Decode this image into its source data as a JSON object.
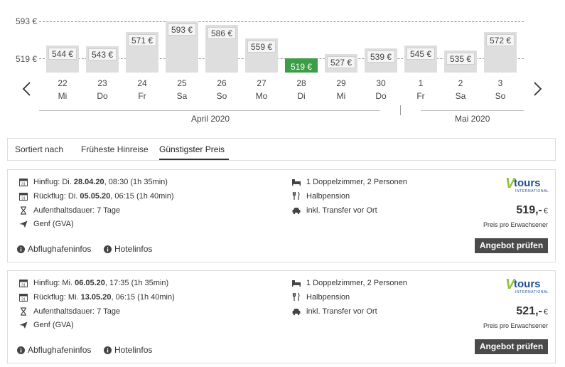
{
  "chart_data": {
    "type": "bar",
    "categories": [
      "22 Mi",
      "23 Do",
      "24 Fr",
      "25 Sa",
      "26 So",
      "27 Mo",
      "28 Di",
      "29 Mi",
      "30 Do",
      "1 Fr",
      "2 Sa",
      "3 So"
    ],
    "days": [
      {
        "num": "22",
        "weekday": "Mi",
        "price_label": "544 €"
      },
      {
        "num": "23",
        "weekday": "Do",
        "price_label": "543 €"
      },
      {
        "num": "24",
        "weekday": "Fr",
        "price_label": "571 €"
      },
      {
        "num": "25",
        "weekday": "Sa",
        "price_label": "593 €"
      },
      {
        "num": "26",
        "weekday": "So",
        "price_label": "586 €"
      },
      {
        "num": "27",
        "weekday": "Mo",
        "price_label": "559 €"
      },
      {
        "num": "28",
        "weekday": "Di",
        "price_label": "519 €"
      },
      {
        "num": "29",
        "weekday": "Mi",
        "price_label": "527 €"
      },
      {
        "num": "30",
        "weekday": "Do",
        "price_label": "539 €"
      },
      {
        "num": "1",
        "weekday": "Fr",
        "price_label": "545 €"
      },
      {
        "num": "2",
        "weekday": "Sa",
        "price_label": "535 €"
      },
      {
        "num": "3",
        "weekday": "So",
        "price_label": "572 €"
      }
    ],
    "values": [
      544,
      543,
      571,
      593,
      586,
      559,
      519,
      527,
      539,
      545,
      535,
      572
    ],
    "selected_index": 6,
    "ref_lines": [
      {
        "value": 593,
        "label": "593 €"
      },
      {
        "value": 519,
        "label": "519 €"
      }
    ],
    "months": [
      {
        "label": "April 2020"
      },
      {
        "label": "Mai 2020"
      }
    ],
    "colors": {
      "bar": "#dedede",
      "selected": "#3d9c46"
    }
  },
  "sort": {
    "label": "Sortiert nach",
    "options": [
      "Früheste Hinreise",
      "Günstigster Preis"
    ],
    "active_index": 1
  },
  "offers": [
    {
      "outbound_prefix": "Hinflug: Di. ",
      "outbound_date": "28.04.20",
      "outbound_suffix": ", 08:30 (1h 35min)",
      "return_prefix": "Rückflug: Di. ",
      "return_date": "05.05.20",
      "return_suffix": ", 06:15 (1h 40min)",
      "duration": "Aufenthaltsdauer: 7 Tage",
      "airport": "Genf (GVA)",
      "room": "1 Doppelzimmer, 2 Personen",
      "board": "Halbpension",
      "transfer": "inkl. Transfer vor Ort",
      "logo_v": "V",
      "logo_text": "tours",
      "logo_sub": "INTERNATIONAL",
      "price": "519,-",
      "currency": "€",
      "price_note": "Preis pro Erwachsener",
      "button": "Angebot prüfen",
      "link_airport": "Abflughafeninfos",
      "link_hotel": "Hotelinfos"
    },
    {
      "outbound_prefix": "Hinflug: Mi. ",
      "outbound_date": "06.05.20",
      "outbound_suffix": ", 17:35 (1h 35min)",
      "return_prefix": "Rückflug: Mi. ",
      "return_date": "13.05.20",
      "return_suffix": ", 06:15 (1h 40min)",
      "duration": "Aufenthaltsdauer: 7 Tage",
      "airport": "Genf (GVA)",
      "room": "1 Doppelzimmer, 2 Personen",
      "board": "Halbpension",
      "transfer": "inkl. Transfer vor Ort",
      "logo_v": "V",
      "logo_text": "tours",
      "logo_sub": "INTERNATIONAL",
      "price": "521,-",
      "currency": "€",
      "price_note": "Preis pro Erwachsener",
      "button": "Angebot prüfen",
      "link_airport": "Abflughafeninfos",
      "link_hotel": "Hotelinfos"
    }
  ],
  "icons": {
    "calendar": "calendar-icon",
    "hourglass": "hourglass-icon",
    "plane": "plane-icon",
    "bed": "bed-icon",
    "cutlery": "cutlery-icon",
    "car": "car-icon",
    "info": "info-icon",
    "prev": "chevron-left-icon",
    "next": "chevron-right-icon"
  }
}
